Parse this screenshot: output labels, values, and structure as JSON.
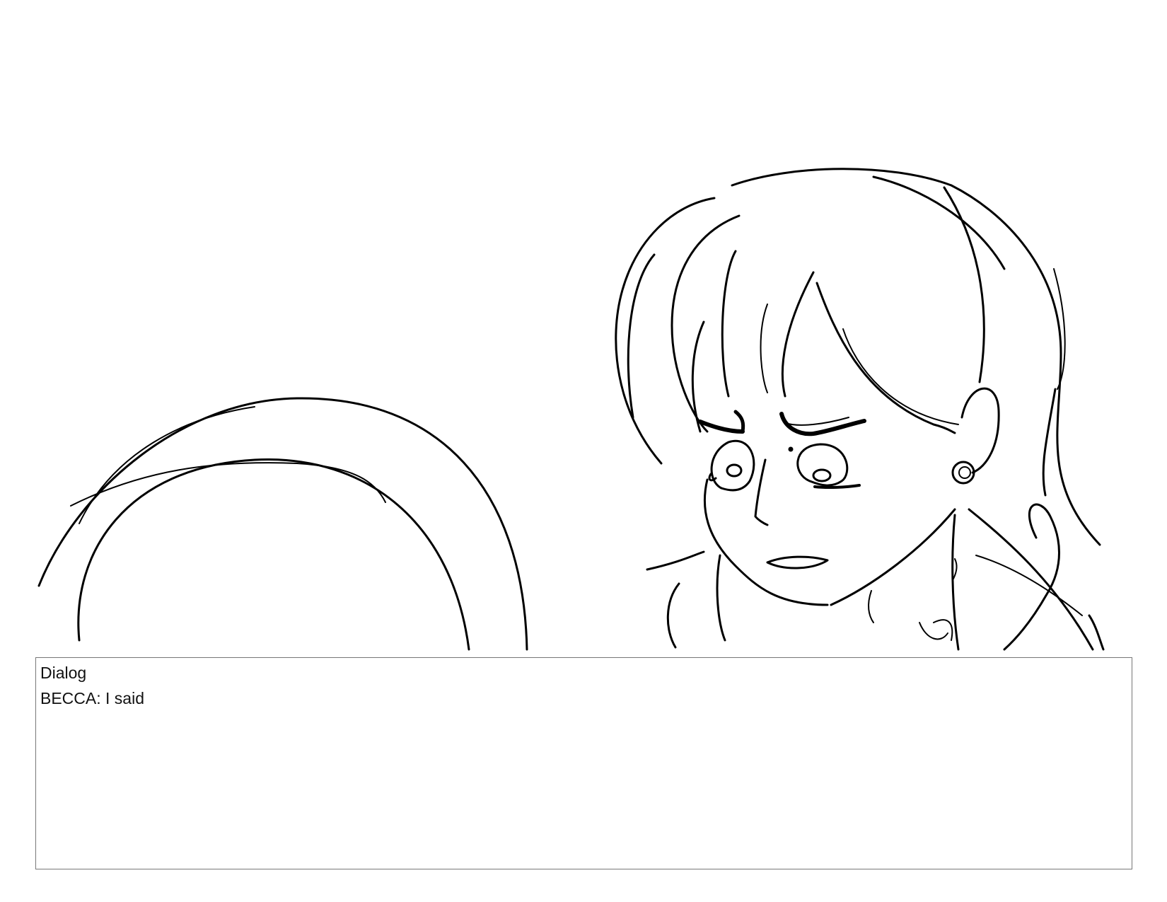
{
  "dialog": {
    "heading": "Dialog",
    "line": "BECCA: I said"
  },
  "panel": {
    "line_color": "#000000",
    "background": "#ffffff"
  }
}
